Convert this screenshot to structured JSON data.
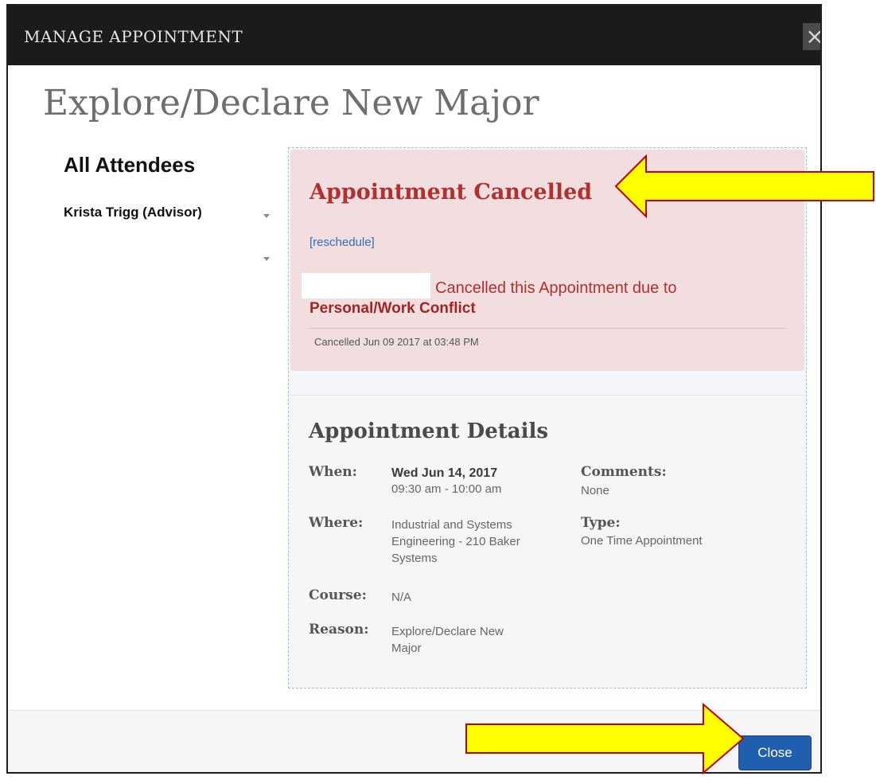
{
  "modal": {
    "title": "MANAGE APPOINTMENT",
    "close_glyph": "×"
  },
  "page": {
    "title": "Explore/Declare New Major"
  },
  "attendees": {
    "heading": "All Attendees",
    "items": [
      {
        "name": "Krista Trigg (Advisor)"
      }
    ]
  },
  "cancellation": {
    "heading": "Appointment Cancelled",
    "reschedule_label": "[reschedule]",
    "message": "Cancelled this Appointment due to",
    "reason": "Personal/Work Conflict",
    "timestamp": "Cancelled Jun 09 2017 at 03:48 PM"
  },
  "details": {
    "heading": "Appointment Details",
    "when_label": "When:",
    "when_date": "Wed Jun 14, 2017",
    "when_time": "09:30 am - 10:00 am",
    "where_label": "Where:",
    "where_line1": "Industrial and Systems",
    "where_line2": "Engineering - 210 Baker",
    "where_line3": "Systems",
    "course_label": "Course:",
    "course_value": "N/A",
    "reason_label": "Reason:",
    "reason_line1": "Explore/Declare New",
    "reason_line2": "Major",
    "comments_label": "Comments:",
    "comments_value": "None",
    "type_label": "Type:",
    "type_value": "One Time Appointment"
  },
  "footer": {
    "close_label": "Close"
  },
  "colors": {
    "title_bar": "#1b1b1b",
    "cancel_bg": "#f2dede",
    "cancel_text": "#b0312f",
    "link": "#2f6fb7",
    "primary_button": "#1f5fae",
    "annotation_arrow_fill": "#ffff00",
    "annotation_arrow_stroke": "#c00000"
  }
}
